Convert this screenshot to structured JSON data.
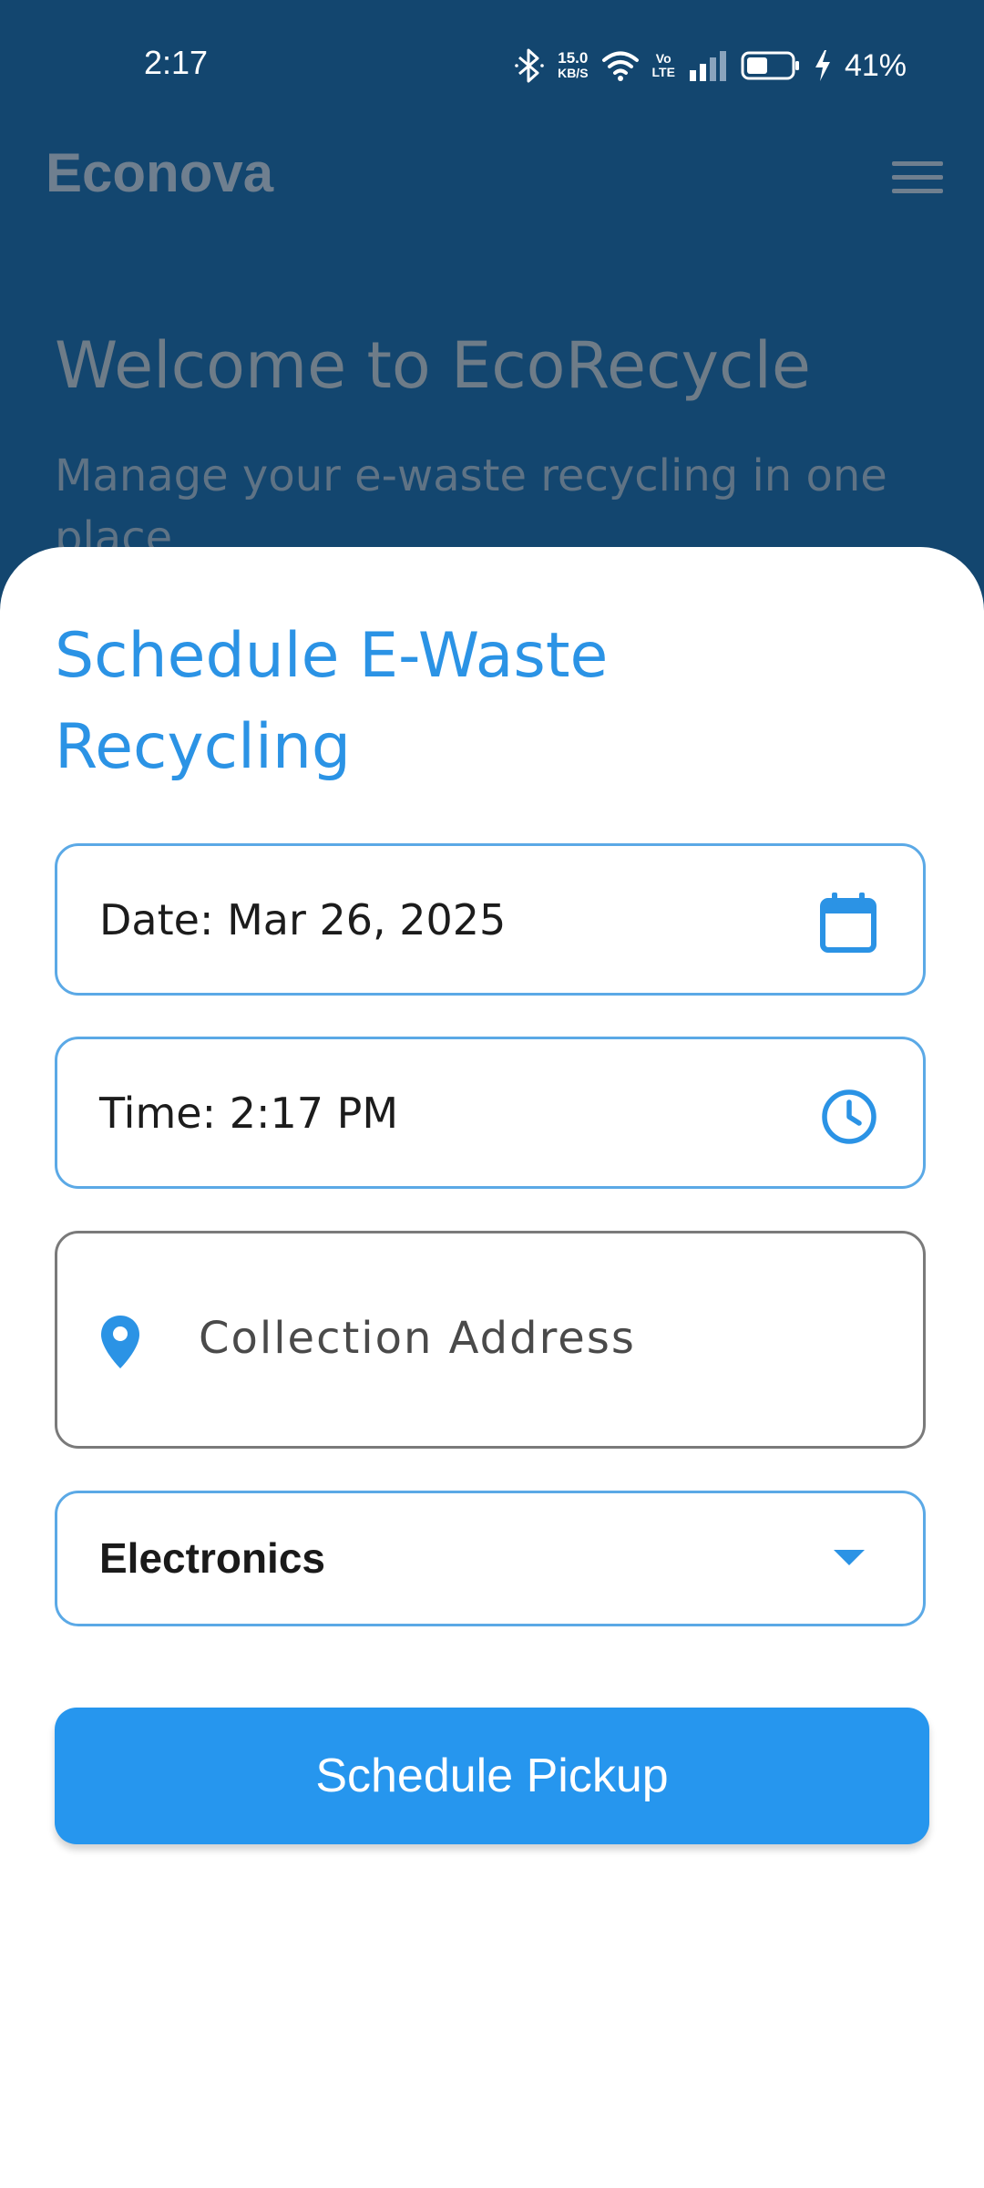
{
  "status_bar": {
    "time": "2:17",
    "network_speed_value": "15.0",
    "network_speed_unit": "KB/S",
    "volte_top": "Vo",
    "volte_bottom": "LTE",
    "battery_percent": "41%",
    "icons": [
      "bluetooth-icon",
      "wifi-icon",
      "signal-icon",
      "battery-icon",
      "charging-icon"
    ]
  },
  "app_bar": {
    "title": "Econova",
    "menu_icon": "menu-icon"
  },
  "welcome": {
    "title": "Welcome to EcoRecycle",
    "subtitle": "Manage your e-waste recycling in one place"
  },
  "sheet": {
    "title": "Schedule E-Waste Recycling",
    "date_field": {
      "label": "Date: Mar 26, 2025",
      "icon": "calendar-icon"
    },
    "time_field": {
      "label": "Time: 2:17 PM",
      "icon": "clock-icon"
    },
    "address_field": {
      "placeholder": "Collection Address",
      "value": "",
      "icon": "location-pin-icon"
    },
    "category_dropdown": {
      "selected": "Electronics",
      "icon": "dropdown-arrow-icon"
    },
    "submit_button": {
      "label": "Schedule Pickup"
    }
  },
  "colors": {
    "header_background": "#13466f",
    "accent": "#2696ee",
    "field_border": "#5ba9e6",
    "title_blue": "#2b93e5"
  }
}
